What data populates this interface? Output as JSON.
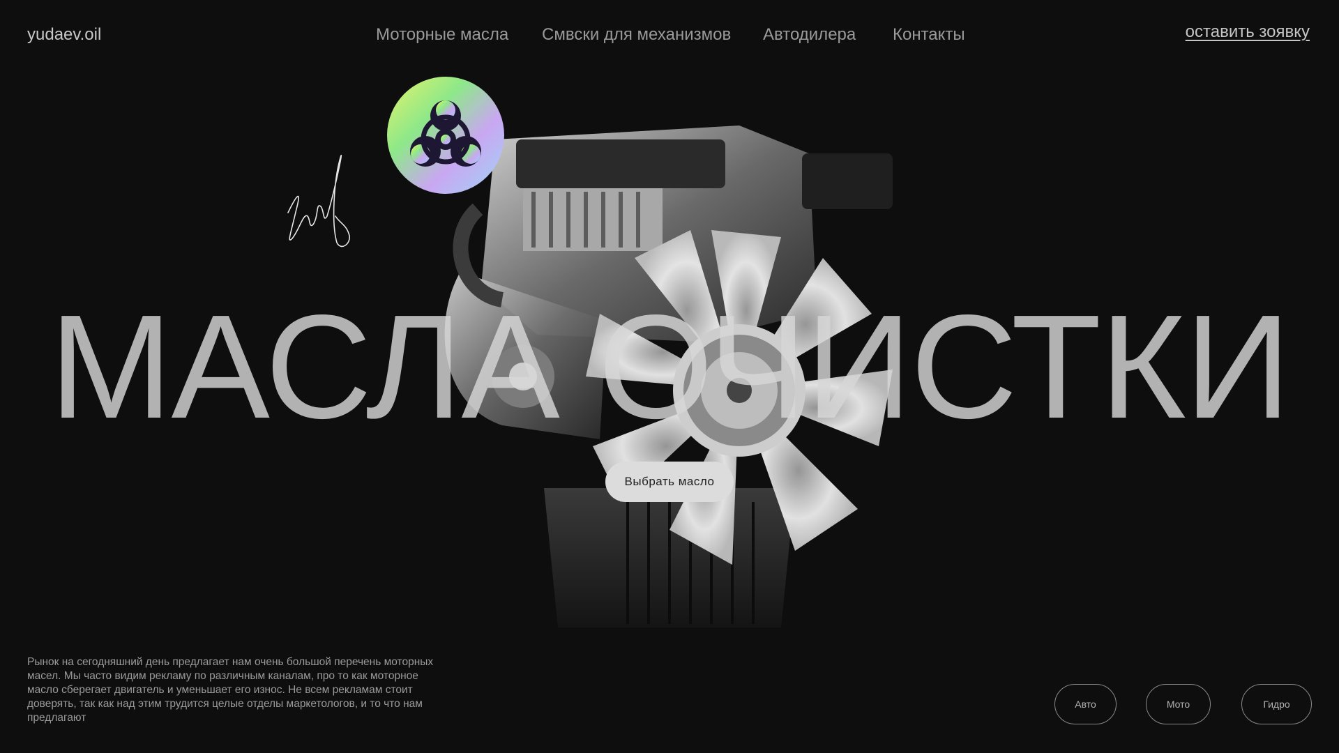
{
  "header": {
    "logo": "yudaev.oil",
    "nav": [
      "Моторные масла",
      "Смвски для механизмов",
      "Автодилера",
      "Контакты"
    ],
    "cta": "оставить зоявку"
  },
  "hero": {
    "headline": "МАСЛА ОЧИСТКИ",
    "button": "Выбрать масло"
  },
  "description": "Рынок на сегодняшний день предлагает нам очень большой перечень моторных масел. Мы часто видим рекламу по различным каналам, про то как моторное масло сберегает двигатель и уменьшает его износ. Не всем рекламам стоит доверять, так как над этим трудится целые отделы маркетологов, и то что нам предлагают",
  "categories": [
    "Авто",
    "Мото",
    "Гидро"
  ],
  "icons": {
    "badge": "biohazard-icon",
    "signature": "signature"
  },
  "colors": {
    "background": "#0e0e0e",
    "text": "#bdbdbd",
    "button_bg": "#dcdcdc"
  }
}
